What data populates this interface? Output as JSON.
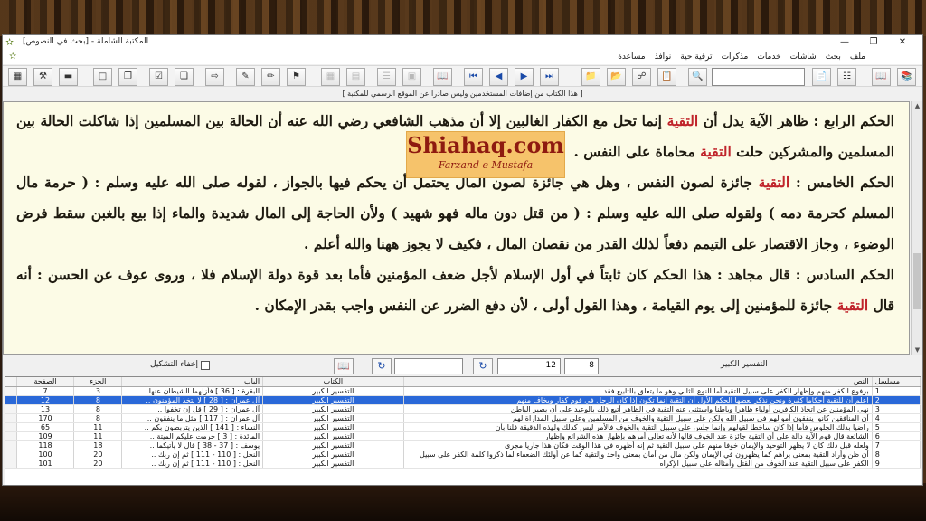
{
  "window": {
    "title": "المكتبة الشاملة - [بحث في النصوص]",
    "controls": [
      "—",
      "❐",
      "✕"
    ]
  },
  "menu": [
    "ملف",
    "بحث",
    "شاشات",
    "خدمات",
    "مذكرات",
    "ترقية حية",
    "نوافذ",
    "مساعدة"
  ],
  "notice": "[ هذا الكتاب من إضافات المستخدمين وليس صادرا عن الموقع الرسمي للمكتبة ]",
  "watermark": {
    "title": "Shiahaq.com",
    "subtitle": "Farzand e Mustafa"
  },
  "content": {
    "p1a": "الحكم الرابع : ظاهر الآية يدل أن ",
    "p1hl": "التقية",
    "p1b": " إنما تحل مع الكفار الغالبين إلا أن مذهب الشافعي رضي الله عنه أن الحالة بين المسلمين إذا شاكلت الحالة بين المسلمين والمشركين حلت ",
    "p1hl2": "التقية",
    "p1c": " محاماة على النفس .",
    "p2a": "الحكم الخامس : ",
    "p2hl": "التقية",
    "p2b": " جائزة لصون النفس ، وهل هي جائزة لصون المال يحتمل أن يحكم فيها بالجواز ، لقوله صلى الله عليه وسلم : ( حرمة مال المسلم كحرمة دمه ) ولقوله صلى الله عليه وسلم : ( من قتل دون ماله فهو شهيد ) ولأن الحاجة إلى المال شديدة والماء إذا بيع بالغبن سقط فرض الوضوء ، وجاز الاقتصار على التيمم دفعاً لذلك القدر من نقصان المال ، فكيف لا يجوز ههنا والله أعلم .",
    "p3a": "الحكم السادس : قال مجاهد : هذا الحكم كان ثابتاً في أول الإسلام لأجل ضعف المؤمنين فأما بعد قوة دولة الإسلام فلا ، وروى عوف عن الحسن : أنه قال ",
    "p3hl": "التقية",
    "p3b": " جائزة للمؤمنين إلى يوم القيامة ، وهذا القول أولى ، لأن دفع الضرر عن النفس واجب بقدر الإمكان ."
  },
  "search_row": {
    "book_label": "التفسير الكبير",
    "part_value": "8",
    "page_value": "12",
    "hide_diacritics_label": "إخفاء التشكيل",
    "go_icon": "refresh-arrow-icon"
  },
  "results": {
    "headers": {
      "num": "مسلسل",
      "text": "النص",
      "book": "الكتاب",
      "chapter": "الباب",
      "part": "الجزء",
      "page": "الصفحة"
    },
    "rows": [
      {
        "num": "1",
        "text": "برفوع الكفر منهم وإظهار الكفر على سبيل التقية أما النوع الثاني وهو ما يتعلق بالتابيع فقد",
        "book": "التفسير الكبير",
        "chapter": "البقرة : [ 36 ] فأزلهما الشيطان عنها ..",
        "part": "3",
        "page": "7"
      },
      {
        "num": "2",
        "text": "اعلم أن للتقية أحكاما كثيرة ونحن نذكر بعضها الحكم الأول أن التقية إنما تكون إذا كان الرجل في قوم كفار ويخاف منهم",
        "book": "التفسير الكبير",
        "chapter": "آل عمران : [ 28 ] لا يتخذ المؤمنون ..",
        "part": "8",
        "page": "12"
      },
      {
        "num": "3",
        "text": "نهى المؤمنين عن اتخاذ الكافرين أولياء ظاهرا وباطنا واستثنى عنه التقية في الظاهر أتبع ذلك بالوعيد على أن يصير الباطن",
        "book": "التفسير الكبير",
        "chapter": "آل عمران : [ 29 ] قل إن تخفوا ..",
        "part": "8",
        "page": "13"
      },
      {
        "num": "4",
        "text": "أن المنافقين كانوا ينفقون أموالهم في سبيل الله ولكن على سبيل التقية والخوف من المسلمين وعلى سبيل المداراة لهم",
        "book": "التفسير الكبير",
        "chapter": "آل عمران : [ 117 ] مثل ما ينفقون ..",
        "part": "8",
        "page": "170"
      },
      {
        "num": "5",
        "text": "راضيا بذلك الجلوس فأما إذا كان ساخطا لقولهم وإنما جلس على سبيل التقية والخوف فالأمر ليس كذلك ولهذه الدقيقة قلنا بأن",
        "book": "التفسير الكبير",
        "chapter": "النساء : [ 141 ] الذين يتربصون بكم ..",
        "part": "11",
        "page": "65"
      },
      {
        "num": "6",
        "text": "الشائعة قال قوم الآية دالة على أن التقية جائزة عند الخوف قالوا لأنه تعالى أمرهم بإظهار هذه الشرائع وإظهار",
        "book": "التفسير الكبير",
        "chapter": "المائدة : [ 3 ] حرمت عليكم الميتة ..",
        "part": "11",
        "page": "109"
      },
      {
        "num": "7",
        "text": "ولعله قبل ذلك كان لا يظهر التوحيد والإيمان خوفا منهم على سبيل التقية ثم إنه أظهره في هذا الوقت فكان هذا جاريا مجرى",
        "book": "التفسير الكبير",
        "chapter": "يوسف : [ 37 - 38 ] قال لا يأتيكما ..",
        "part": "18",
        "page": "118"
      },
      {
        "num": "8",
        "text": "أن ظن وأراد التقية بمعنى يراهم كما يظهرون في الإيمان ولكن مال من أمان بمعنى واحد وإلتقية كما عن أولئك الضعفاء لما ذكروا كلمة الكفر على سبيل",
        "book": "التفسير الكبير",
        "chapter": "النحل : [ 110 - 111 ] ثم إن ربك ..",
        "part": "20",
        "page": "100"
      },
      {
        "num": "9",
        "text": "الكفر على سبيل التقية عند الخوف من القتل وأمثاله على سبيل الإكراه",
        "book": "التفسير الكبير",
        "chapter": "النحل : [ 110 - 111 ] ثم إن ربك ..",
        "part": "20",
        "page": "101"
      }
    ],
    "selected_index": 1
  }
}
